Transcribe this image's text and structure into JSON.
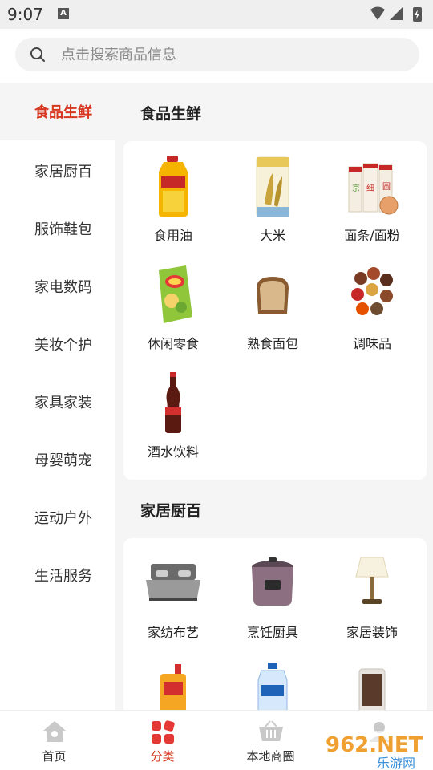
{
  "status": {
    "time": "9:07",
    "notification_badge": "A"
  },
  "search": {
    "placeholder": "点击搜索商品信息"
  },
  "sidebar": {
    "items": [
      {
        "label": "食品生鲜",
        "active": true
      },
      {
        "label": "家居厨百"
      },
      {
        "label": "服饰鞋包"
      },
      {
        "label": "家电数码"
      },
      {
        "label": "美妆个护"
      },
      {
        "label": "家具家装"
      },
      {
        "label": "母婴萌宠"
      },
      {
        "label": "运动户外"
      },
      {
        "label": "生活服务"
      }
    ]
  },
  "main": {
    "sections": [
      {
        "title": "食品生鲜",
        "items": [
          {
            "label": "食用油",
            "icon": "cooking-oil-icon"
          },
          {
            "label": "大米",
            "icon": "rice-bag-icon"
          },
          {
            "label": "面条/面粉",
            "icon": "noodles-flour-icon"
          },
          {
            "label": "休闲零食",
            "icon": "snack-chips-icon"
          },
          {
            "label": "熟食面包",
            "icon": "bread-icon"
          },
          {
            "label": "调味品",
            "icon": "spices-icon"
          },
          {
            "label": "酒水饮料",
            "icon": "cola-bottle-icon"
          }
        ]
      },
      {
        "title": "家居厨百",
        "items": [
          {
            "label": "家纺布艺",
            "icon": "bed-icon"
          },
          {
            "label": "烹饪厨具",
            "icon": "pressure-cooker-icon"
          },
          {
            "label": "家居装饰",
            "icon": "lamp-icon"
          },
          {
            "label": "",
            "icon": "dish-soap-icon"
          },
          {
            "label": "",
            "icon": "detergent-icon"
          },
          {
            "label": "",
            "icon": "cup-icon"
          }
        ]
      }
    ]
  },
  "bottom_nav": {
    "items": [
      {
        "label": "首页",
        "icon": "home-icon"
      },
      {
        "label": "分类",
        "icon": "category-icon",
        "active": true
      },
      {
        "label": "本地商圈",
        "icon": "basket-icon"
      },
      {
        "label": "",
        "icon": "profile-icon"
      }
    ]
  },
  "watermark": {
    "text": "962.NET",
    "subtext": "乐游网"
  },
  "colors": {
    "accent": "#d8371f",
    "background": "#f5f5f5",
    "card": "#ffffff"
  }
}
